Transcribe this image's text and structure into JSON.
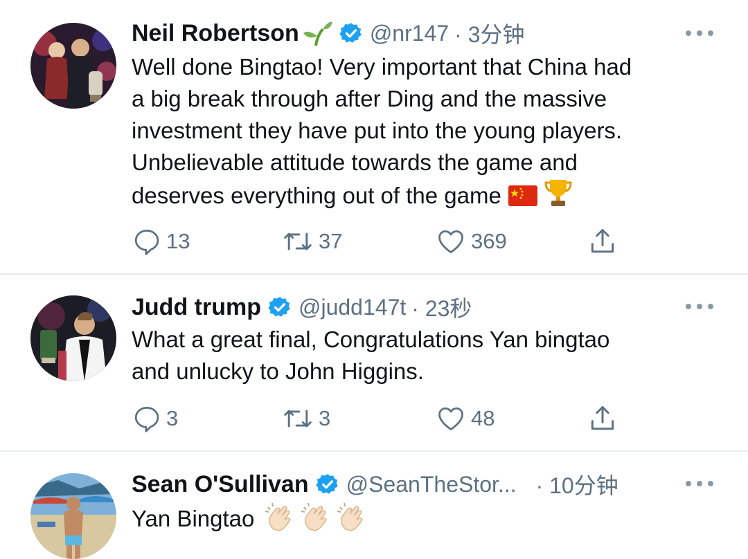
{
  "tweets": [
    {
      "name": "Neil Robertson",
      "handle": "@nr147",
      "time": "· 3分钟",
      "lines": [
        "Well done Bingtao! Very important that China had",
        "a big break through after Ding and the massive",
        "investment they have put into the young players.",
        "Unbelievable attitude towards the game and",
        "deserves everything out of the game"
      ],
      "replies": "13",
      "retweets": "37",
      "likes": "369"
    },
    {
      "name": "Judd trump",
      "handle": "@judd147t",
      "time": "· 23秒",
      "lines": [
        "What a great final, Congratulations Yan bingtao",
        "and unlucky to John Higgins."
      ],
      "replies": "3",
      "retweets": "3",
      "likes": "48"
    },
    {
      "name": "Sean O'Sullivan",
      "handle": "@SeanTheStor...",
      "time": "· 10分钟",
      "lines": [
        "Yan Bingtao"
      ]
    }
  ],
  "icons": {
    "verified": "verified-badge-icon",
    "sprout": "sprout-emoji-icon",
    "flag": "china-flag-emoji-icon",
    "trophy": "trophy-emoji-icon",
    "clap": "clapping-hands-emoji-icon",
    "reply": "reply-bubble-icon",
    "retweet": "retweet-icon",
    "like": "heart-icon",
    "share": "share-icon",
    "more": "more-options-icon"
  },
  "colors": {
    "verified_blue": "#1da1f2",
    "secondary_text": "#5b7083",
    "divider": "#e6ecf0"
  }
}
